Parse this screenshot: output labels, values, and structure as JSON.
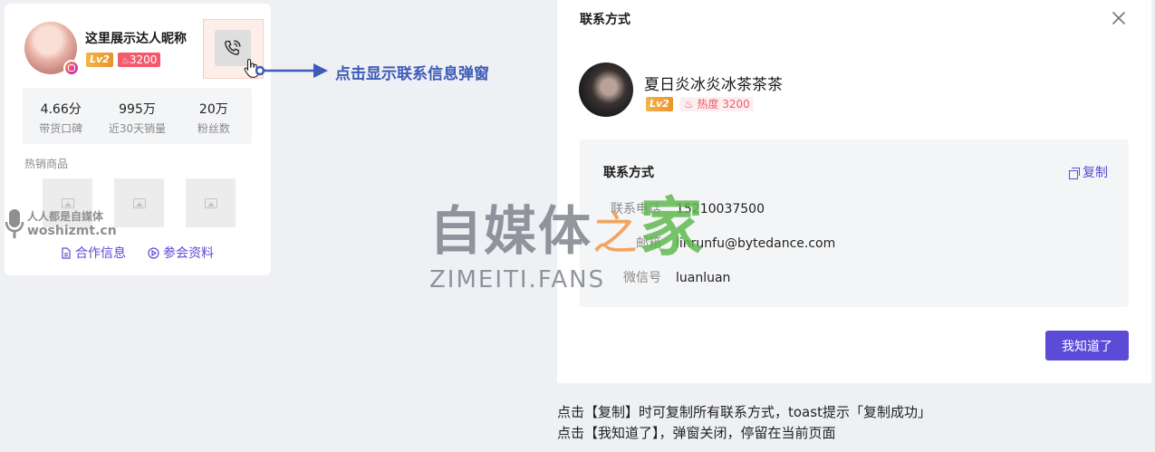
{
  "card": {
    "nickname": "这里展示达人昵称",
    "level": "Lv2",
    "heat": "3200",
    "stats": [
      {
        "value": "4.66分",
        "label": "带货口碑"
      },
      {
        "value": "995万",
        "label": "近30天销量"
      },
      {
        "value": "20万",
        "label": "粉丝数"
      }
    ],
    "hot_products_title": "热销商品",
    "links": {
      "cooperation": "合作信息",
      "materials": "参会资料"
    }
  },
  "annotation": {
    "arrow_label": "点击显示联系信息弹窗"
  },
  "watermark": {
    "small_line1": "人人都是自媒体",
    "small_line2": "woshizmt.cn",
    "big_part1": "自媒体",
    "big_part2": "之",
    "big_part3": "家",
    "big_en": "ZIMEITI.FANS"
  },
  "modal": {
    "title": "联系方式",
    "name": "夏日炎冰炎冰茶茶茶",
    "level": "Lv2",
    "heat_label": "热度 3200",
    "panel_title": "联系方式",
    "copy_label": "复制",
    "fields": [
      {
        "key": "联系电话",
        "value": "15210037500"
      },
      {
        "key": "邮箱",
        "value": "linrunfu@bytedance.com"
      },
      {
        "key": "微信号",
        "value": "luanluan"
      }
    ],
    "ok_button": "我知道了"
  },
  "notes": {
    "line1": "点击【复制】时可复制所有联系方式，toast提示「复制成功」",
    "line2": "点击【我知道了】，弹窗关闭，停留在当前页面"
  },
  "colors": {
    "accent": "#5b4bd6",
    "annotation": "#3d5bb8",
    "heat": "#f35a6c",
    "level": "#f2b448"
  }
}
